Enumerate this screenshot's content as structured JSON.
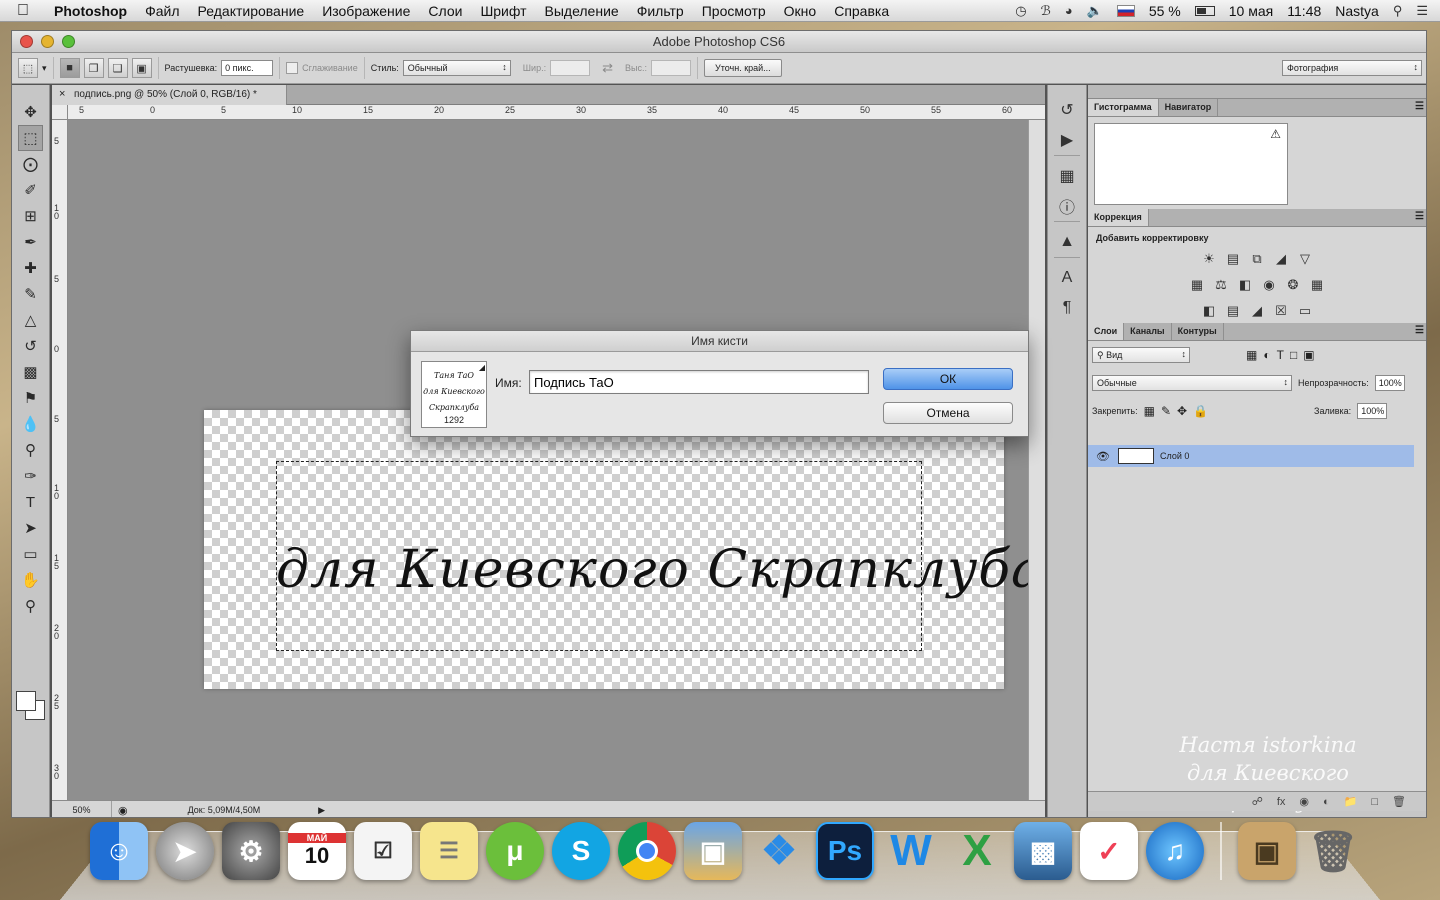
{
  "menubar": {
    "app_name": "Photoshop",
    "items": [
      "Файл",
      "Редактирование",
      "Изображение",
      "Слои",
      "Шрифт",
      "Выделение",
      "Фильтр",
      "Просмотр",
      "Окно",
      "Справка"
    ],
    "battery": "55 %",
    "date": "10 мая",
    "time": "11:48",
    "user": "Nastya"
  },
  "window": {
    "title": "Adobe Photoshop CS6"
  },
  "options": {
    "feather_label": "Растушевка:",
    "feather_value": "0 пикс.",
    "antialias_label": "Сглаживание",
    "style_label": "Стиль:",
    "style_value": "Обычный",
    "width_label": "Шир.:",
    "height_label": "Выс.:",
    "refine_button": "Уточн. край...",
    "workspace_value": "Фотография"
  },
  "document": {
    "tab_title": "подпись.png @ 50% (Слой 0, RGB/16) *",
    "zoom": "50%",
    "doc_info": "Док: 5,09M/4,50M",
    "image_text": "для Киевского Скрапклуба",
    "ruler_h": [
      "5",
      "0",
      "5",
      "10",
      "15",
      "20",
      "25",
      "30",
      "35",
      "40",
      "45",
      "50",
      "55",
      "60"
    ],
    "ruler_v": [
      "5",
      "1 0",
      "5",
      "0",
      "5",
      "1 0",
      "1 5",
      "2 0",
      "2 5",
      "3 0"
    ]
  },
  "panels": {
    "histogram_tab": "Гистограмма",
    "navigator_tab": "Навигатор",
    "correction_tab": "Коррекция",
    "add_correction": "Добавить корректировку",
    "layers_tab": "Слои",
    "channels_tab": "Каналы",
    "paths_tab": "Контуры",
    "filter_kind": "Вид",
    "blend_mode": "Обычные",
    "opacity_label": "Непрозрачность:",
    "opacity_value": "100%",
    "lock_label": "Закрепить:",
    "fill_label": "Заливка:",
    "fill_value": "100%",
    "layer_name": "Слой 0",
    "watermark_line1": "Настя istorkina",
    "watermark_line2": "для Киевского Скрапклуба"
  },
  "dialog": {
    "title": "Имя кисти",
    "name_label": "Имя:",
    "name_value": "Подпись ТаО",
    "ok": "ОК",
    "cancel": "Отмена",
    "brush_size": "1292",
    "preview_line1": "Таня ТаО",
    "preview_line2": "для Киевского Скрапклуба"
  },
  "dock": {
    "apps": [
      "finder",
      "launchpad",
      "system-preferences",
      "calendar",
      "reminders",
      "stickies",
      "utorrent",
      "skype",
      "chrome",
      "iphoto",
      "dropbox",
      "photoshop",
      "word",
      "excel",
      "screen-sharing",
      "pocket",
      "itunes",
      "photos-stack",
      "trash"
    ],
    "calendar_month": "МАЙ",
    "calendar_day": "10"
  },
  "colors": {
    "accent_blue": "#4f93e8",
    "selected_layer": "#9fbbe8"
  }
}
